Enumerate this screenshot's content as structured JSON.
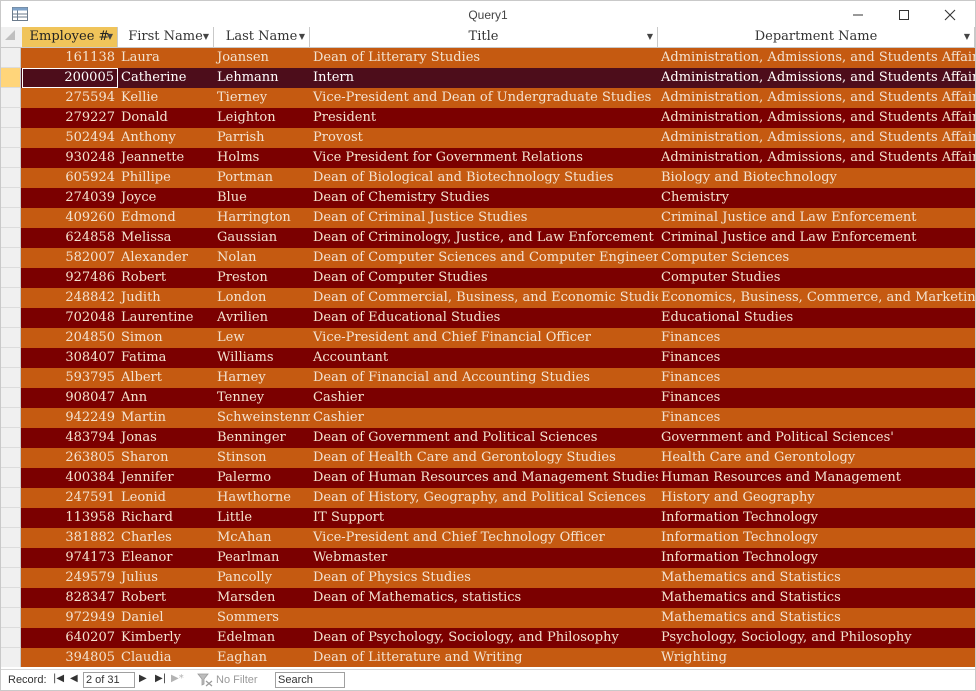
{
  "window": {
    "title": "Query1"
  },
  "columns": [
    {
      "label": "Employee #",
      "sort_icon": "chevron-down-icon"
    },
    {
      "label": "First Name",
      "sort_icon": "chevron-down-icon"
    },
    {
      "label": "Last Name",
      "sort_icon": "chevron-down-icon"
    },
    {
      "label": "Title",
      "sort_icon": "chevron-down-icon"
    },
    {
      "label": "Department Name",
      "sort_icon": "chevron-down-icon"
    }
  ],
  "rows": [
    {
      "emp": "161138",
      "first": "Laura",
      "last": "Joansen",
      "title": "Dean of Litterary Studies",
      "dept": "Administration, Admissions, and Students Affairs"
    },
    {
      "emp": "200005",
      "first": "Catherine",
      "last": "Lehmann",
      "title": "Intern",
      "dept": "Administration, Admissions, and Students Affairs"
    },
    {
      "emp": "275594",
      "first": "Kellie",
      "last": "Tierney",
      "title": "Vice-President and Dean of Undergraduate Studies",
      "dept": "Administration, Admissions, and Students Affairs"
    },
    {
      "emp": "279227",
      "first": "Donald",
      "last": "Leighton",
      "title": "President",
      "dept": "Administration, Admissions, and Students Affairs"
    },
    {
      "emp": "502494",
      "first": "Anthony",
      "last": "Parrish",
      "title": "Provost",
      "dept": "Administration, Admissions, and Students Affairs"
    },
    {
      "emp": "930248",
      "first": "Jeannette",
      "last": "Holms",
      "title": "Vice President for Government Relations",
      "dept": "Administration, Admissions, and Students Affairs"
    },
    {
      "emp": "605924",
      "first": "Phillipe",
      "last": "Portman",
      "title": "Dean of Biological and Biotechnology Studies",
      "dept": "Biology and Biotechnology"
    },
    {
      "emp": "274039",
      "first": "Joyce",
      "last": "Blue",
      "title": "Dean of Chemistry Studies",
      "dept": "Chemistry"
    },
    {
      "emp": "409260",
      "first": "Edmond",
      "last": "Harrington",
      "title": "Dean of Criminal Justice Studies",
      "dept": "Criminal Justice and Law Enforcement"
    },
    {
      "emp": "624858",
      "first": "Melissa",
      "last": "Gaussian",
      "title": "Dean of Criminology, Justice, and Law Enforcement",
      "dept": "Criminal Justice and Law Enforcement"
    },
    {
      "emp": "582007",
      "first": "Alexander",
      "last": "Nolan",
      "title": "Dean of Computer Sciences and Computer Engineering",
      "dept": "Computer Sciences"
    },
    {
      "emp": "927486",
      "first": "Robert",
      "last": "Preston",
      "title": "Dean of Computer Studies",
      "dept": "Computer Studies"
    },
    {
      "emp": "248842",
      "first": "Judith",
      "last": "London",
      "title": "Dean of Commercial, Business, and Economic Studies",
      "dept": "Economics, Business, Commerce, and Marketing"
    },
    {
      "emp": "702048",
      "first": "Laurentine",
      "last": "Avrilien",
      "title": "Dean of Educational Studies",
      "dept": "Educational Studies"
    },
    {
      "emp": "204850",
      "first": "Simon",
      "last": "Lew",
      "title": "Vice-President and Chief Financial Officer",
      "dept": "Finances"
    },
    {
      "emp": "308407",
      "first": "Fatima",
      "last": "Williams",
      "title": "Accountant",
      "dept": "Finances"
    },
    {
      "emp": "593795",
      "first": "Albert",
      "last": "Harney",
      "title": "Dean of Financial and Accounting Studies",
      "dept": "Finances"
    },
    {
      "emp": "908047",
      "first": "Ann",
      "last": "Tenney",
      "title": "Cashier",
      "dept": "Finances"
    },
    {
      "emp": "942249",
      "first": "Martin",
      "last": "Schweinstenman",
      "title": "Cashier",
      "dept": "Finances"
    },
    {
      "emp": "483794",
      "first": "Jonas",
      "last": "Benninger",
      "title": "Dean of Government and Political Sciences",
      "dept": "Government and Political Sciences'"
    },
    {
      "emp": "263805",
      "first": "Sharon",
      "last": "Stinson",
      "title": "Dean of Health Care and Gerontology Studies",
      "dept": "Health Care and Gerontology"
    },
    {
      "emp": "400384",
      "first": "Jennifer",
      "last": "Palermo",
      "title": "Dean of Human Resources and Management Studies",
      "dept": "Human Resources and Management"
    },
    {
      "emp": "247591",
      "first": "Leonid",
      "last": "Hawthorne",
      "title": "Dean of History, Geography, and Political Sciences",
      "dept": "History and Geography"
    },
    {
      "emp": "113958",
      "first": "Richard",
      "last": "Little",
      "title": "IT Support",
      "dept": "Information Technology"
    },
    {
      "emp": "381882",
      "first": "Charles",
      "last": "McAhan",
      "title": "Vice-President and Chief Technology Officer",
      "dept": "Information Technology"
    },
    {
      "emp": "974173",
      "first": "Eleanor",
      "last": "Pearlman",
      "title": "Webmaster",
      "dept": "Information Technology"
    },
    {
      "emp": "249579",
      "first": "Julius",
      "last": "Pancolly",
      "title": "Dean of Physics Studies",
      "dept": "Mathematics and Statistics"
    },
    {
      "emp": "828347",
      "first": "Robert",
      "last": "Marsden",
      "title": "Dean of Mathematics, statistics",
      "dept": "Mathematics and Statistics"
    },
    {
      "emp": "972949",
      "first": "Daniel",
      "last": "Sommers",
      "title": "",
      "dept": "Mathematics and Statistics"
    },
    {
      "emp": "640207",
      "first": "Kimberly",
      "last": "Edelman",
      "title": "Dean of Psychology, Sociology, and Philosophy",
      "dept": "Psychology, Sociology, and Philosophy"
    },
    {
      "emp": "394805",
      "first": "Claudia",
      "last": "Eaghan",
      "title": "Dean of Litterature and Writing",
      "dept": "Wrighting"
    }
  ],
  "current_row_index": 1,
  "navigation": {
    "record_label": "Record:",
    "record_value": "2 of 31",
    "filter_label": "No Filter",
    "search_placeholder": "Search"
  },
  "colors": {
    "row_light": "#c55a11",
    "row_dark": "#7b0000",
    "row_current": "#4d0d1b",
    "selected_header": "#f0c45a"
  }
}
